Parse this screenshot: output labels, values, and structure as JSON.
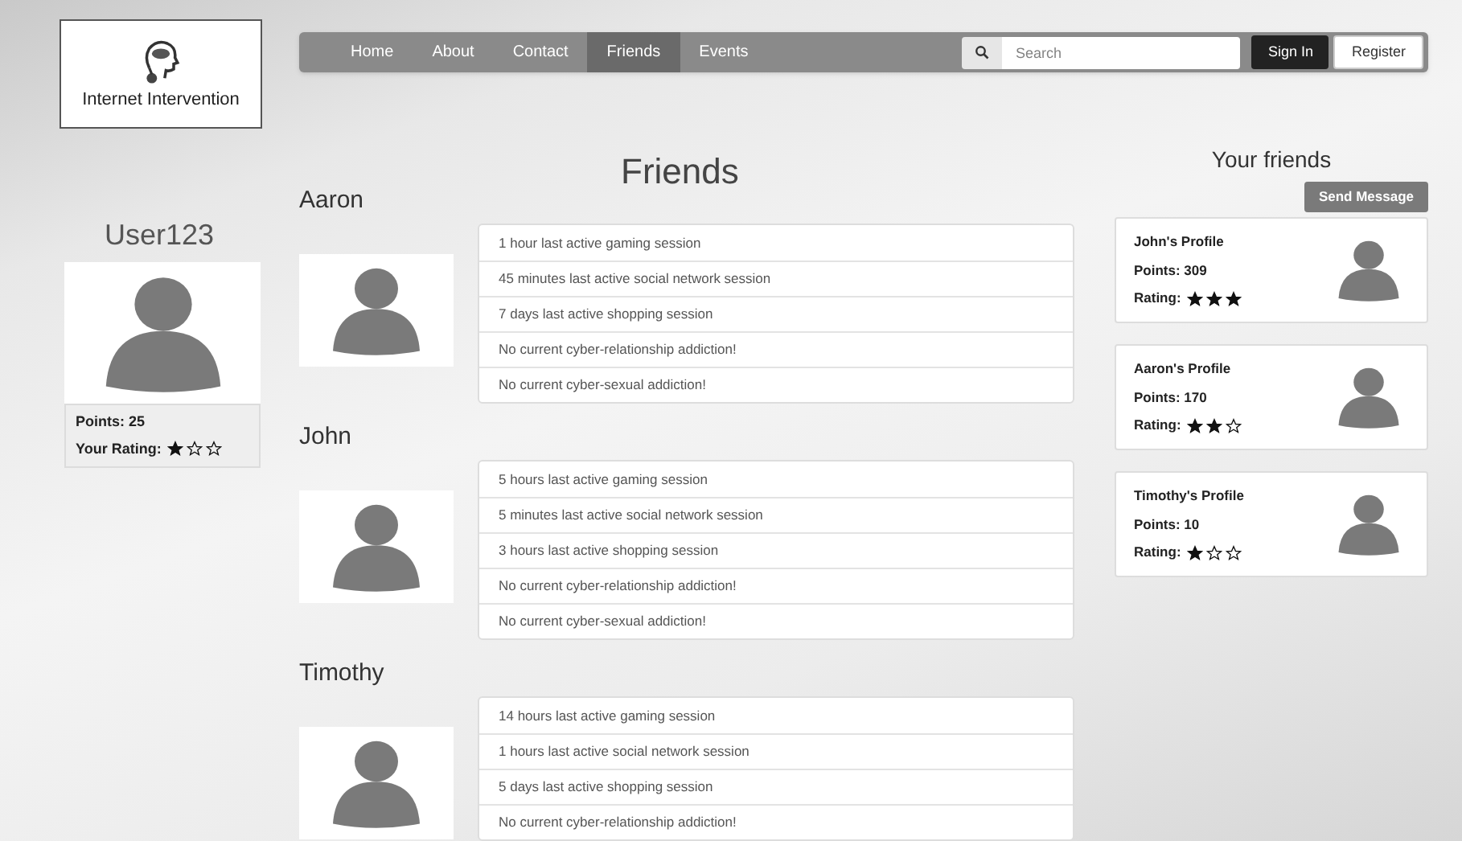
{
  "logo": {
    "text": "Internet Intervention"
  },
  "nav": {
    "items": [
      {
        "label": "Home",
        "selected": false
      },
      {
        "label": "About",
        "selected": false
      },
      {
        "label": "Contact",
        "selected": false
      },
      {
        "label": "Friends",
        "selected": true
      },
      {
        "label": "Events",
        "selected": false
      }
    ],
    "search": {
      "placeholder": "Search"
    },
    "buttons": [
      {
        "label": "Sign In",
        "kind": "dark"
      },
      {
        "label": "Register",
        "kind": "light"
      }
    ]
  },
  "user": {
    "name": "User123",
    "points": "Points: 25",
    "rating_label": "Your Rating:",
    "stars": 1
  },
  "page_title": "Friends",
  "friends": [
    {
      "name": "Aaron",
      "activity": [
        "1 hour last active gaming session",
        "45 minutes last active social network session",
        "7 days last active shopping session",
        "No current cyber-relationship addiction!",
        "No current cyber-sexual addiction!"
      ]
    },
    {
      "name": "John",
      "activity": [
        "5 hours last active gaming session",
        "5 minutes last active social network session",
        "3 hours last active shopping session",
        "No current cyber-relationship addiction!",
        "No current cyber-sexual addiction!"
      ]
    },
    {
      "name": "Timothy",
      "activity": [
        "14 hours last active gaming session",
        "1 hours last active social network session",
        "5 days last active shopping session",
        "No current cyber-relationship addiction!"
      ]
    }
  ],
  "your_friends": {
    "title": "Your friends",
    "button": "Send Message",
    "cards": [
      {
        "title": "John's Profile",
        "points": "Points: 309",
        "rating_label": "Rating:",
        "stars": 3
      },
      {
        "title": "Aaron's Profile",
        "points": "Points: 170",
        "rating_label": "Rating:",
        "stars": 2
      },
      {
        "title": "Timothy's Profile",
        "points": "Points: 10",
        "rating_label": "Rating:",
        "stars": 1
      }
    ]
  }
}
